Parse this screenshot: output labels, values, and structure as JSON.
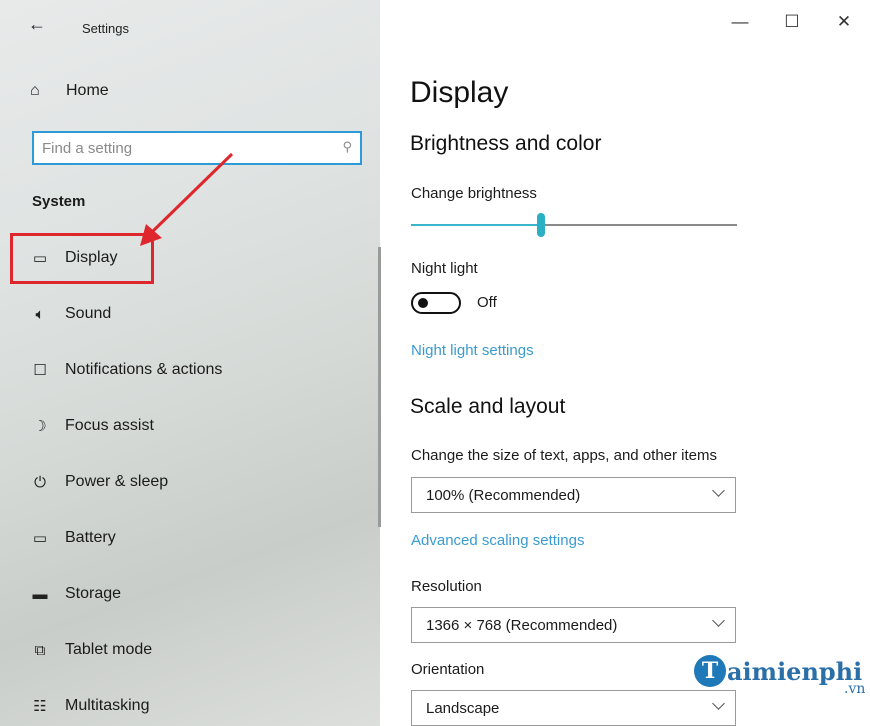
{
  "window": {
    "title": "Settings",
    "back_icon": "←",
    "controls": {
      "minimize": "—",
      "maximize": "☐",
      "close": "✕"
    }
  },
  "sidebar": {
    "home": {
      "icon": "⌂",
      "label": "Home"
    },
    "search": {
      "placeholder": "Find a setting",
      "icon": "⚲"
    },
    "section_title": "System",
    "items": [
      {
        "icon_name": "monitor-icon",
        "icon": "▭",
        "label": "Display"
      },
      {
        "icon_name": "speaker-icon",
        "icon": "🔈︎",
        "label": "Sound"
      },
      {
        "icon_name": "notification-icon",
        "icon": "☐",
        "label": "Notifications & actions"
      },
      {
        "icon_name": "moon-icon",
        "icon": "☽",
        "label": "Focus assist"
      },
      {
        "icon_name": "power-icon",
        "icon": "⏻",
        "label": "Power & sleep"
      },
      {
        "icon_name": "battery-icon",
        "icon": "▭",
        "label": "Battery"
      },
      {
        "icon_name": "storage-icon",
        "icon": "▬",
        "label": "Storage"
      },
      {
        "icon_name": "tablet-icon",
        "icon": "⧉",
        "label": "Tablet mode"
      },
      {
        "icon_name": "multitasking-icon",
        "icon": "☷",
        "label": "Multitasking"
      }
    ]
  },
  "main": {
    "title": "Display",
    "brightness_section": "Brightness and color",
    "brightness_label": "Change brightness",
    "brightness_value": 0.4,
    "night_light_label": "Night light",
    "night_light_state": "Off",
    "night_light_link": "Night light settings",
    "scale_section": "Scale and layout",
    "scale_label": "Change the size of text, apps, and other items",
    "scale_value": "100% (Recommended)",
    "advanced_link": "Advanced scaling settings",
    "resolution_label": "Resolution",
    "resolution_value": "1366 × 768 (Recommended)",
    "orientation_label": "Orientation",
    "orientation_value": "Landscape"
  },
  "watermark": {
    "letter": "T",
    "text": "aimienphi",
    "suffix": ".vn"
  },
  "colors": {
    "accent": "#2ab0c4",
    "link": "#3a9bd0",
    "highlight": "#e0262d",
    "search_border": "#2e9bd6"
  }
}
